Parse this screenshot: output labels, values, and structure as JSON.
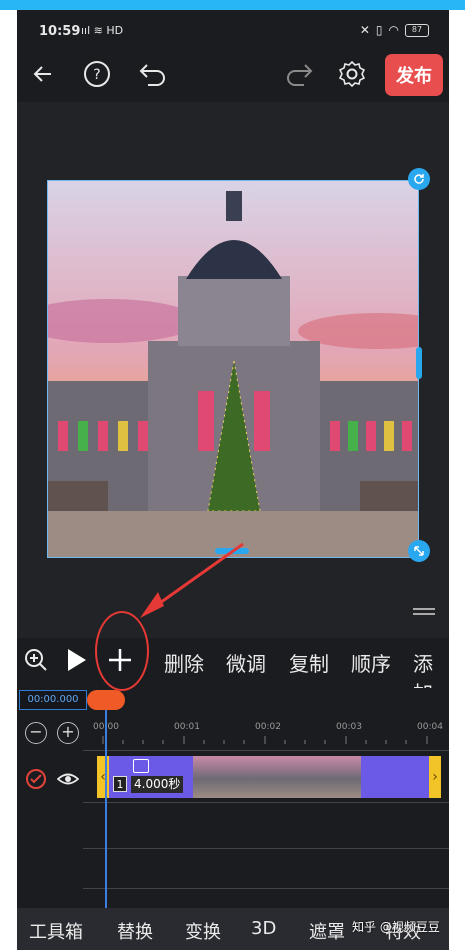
{
  "status": {
    "time": "10:59",
    "signal": "ııl ≋ HD",
    "battery": "87"
  },
  "toolbar": {
    "back_icon": "back-arrow-icon",
    "help_icon": "help-icon",
    "undo_icon": "undo-icon",
    "redo_icon": "redo-icon",
    "settings_icon": "gear-icon",
    "publish_label": "发布"
  },
  "actions": {
    "zoom_icon": "zoom-in-icon",
    "play_icon": "play-icon",
    "add_icon": "plus-icon",
    "items": [
      "删除",
      "微调",
      "复制",
      "顺序",
      "添加"
    ]
  },
  "timeline": {
    "timecode": "00:00.000",
    "ticks": [
      "00:00",
      "00:01",
      "00:02",
      "00:03",
      "00:04"
    ],
    "clip": {
      "index": "1",
      "duration": "4.000秒"
    }
  },
  "tabs": [
    "工具箱",
    "替换",
    "变换",
    "3D",
    "遮罩",
    "特效"
  ],
  "watermark": "知乎 @视频豆豆",
  "colors": {
    "accent": "#29a8f0",
    "publish": "#e84e4e",
    "clip": "#6a5ae6",
    "grip": "#f2c428",
    "annotation": "#e53935"
  }
}
